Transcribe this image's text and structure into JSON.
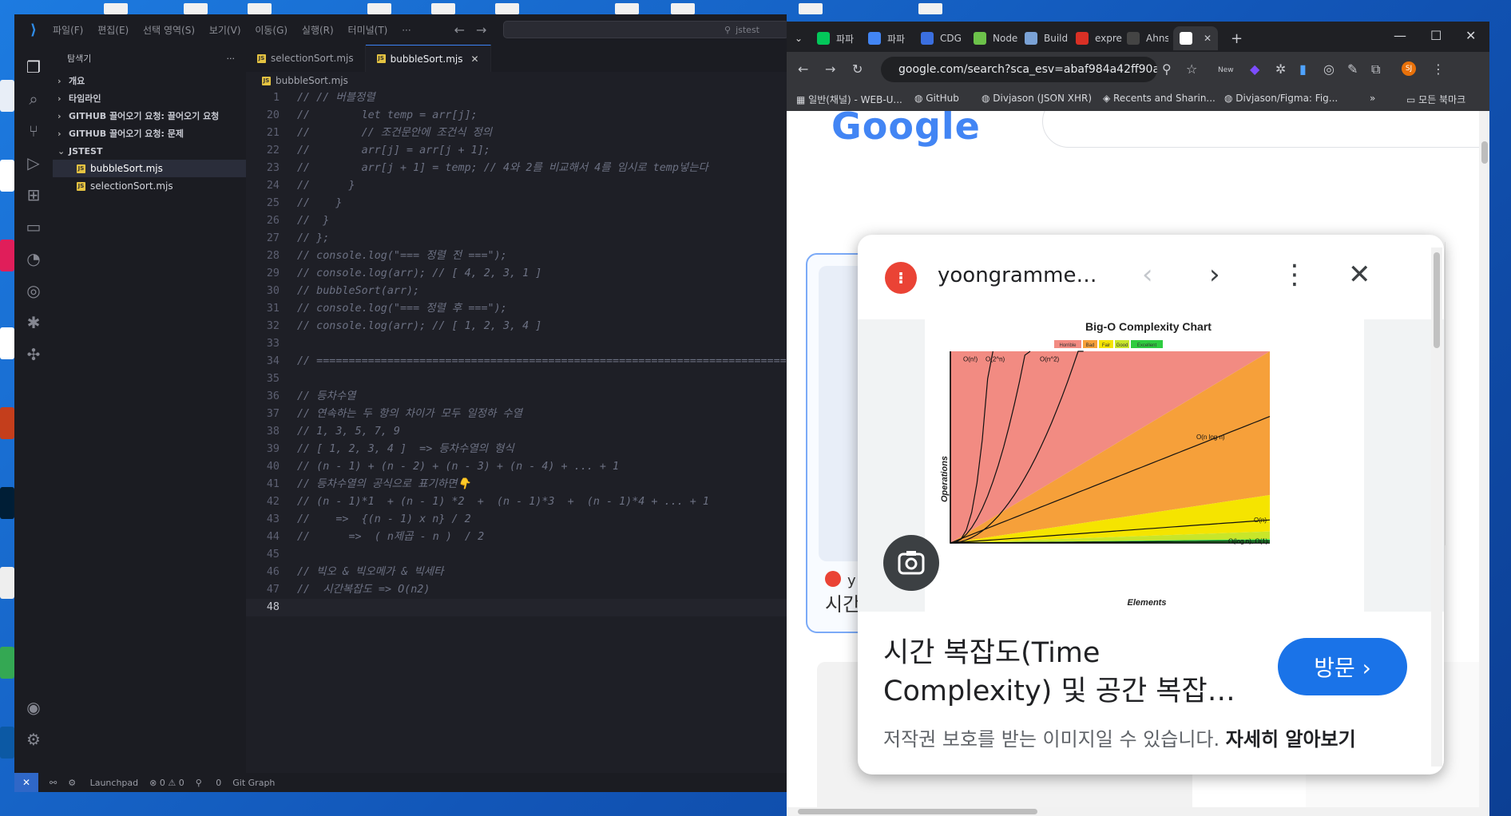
{
  "vscode": {
    "menu": [
      "파일(F)",
      "편집(E)",
      "선택 영역(S)",
      "보기(V)",
      "이동(G)",
      "실행(R)",
      "터미널(T)",
      "···"
    ],
    "search_text": "jstest",
    "explorer_title": "탐색기",
    "explorer_more": "···",
    "sections": [
      "개요",
      "타임라인",
      "GITHUB 끌어오기 요청: 끌어오기 요청",
      "GITHUB 끌어오기 요청: 문제"
    ],
    "folder": "JSTEST",
    "files": [
      "bubbleSort.mjs",
      "selectionSort.mjs"
    ],
    "tabs": [
      {
        "label": "selectionSort.mjs"
      },
      {
        "label": "bubbleSort.mjs"
      }
    ],
    "breadcrumb": "bubbleSort.mjs",
    "lines": [
      {
        "n": "1",
        "t": "// // 버블정렬"
      },
      {
        "n": "20",
        "t": "//        let temp = arr[j];"
      },
      {
        "n": "21",
        "t": "//        // 조건문안에 조건식 정의"
      },
      {
        "n": "22",
        "t": "//        arr[j] = arr[j + 1];"
      },
      {
        "n": "23",
        "t": "//        arr[j + 1] = temp; // 4와 2를 비교해서 4를 임시로 temp넣는다"
      },
      {
        "n": "24",
        "t": "//      }"
      },
      {
        "n": "25",
        "t": "//    }"
      },
      {
        "n": "26",
        "t": "//  }"
      },
      {
        "n": "27",
        "t": "// };"
      },
      {
        "n": "28",
        "t": "// console.log(\"=== 정렬 전 ===\");"
      },
      {
        "n": "29",
        "t": "// console.log(arr); // [ 4, 2, 3, 1 ]"
      },
      {
        "n": "30",
        "t": "// bubbleSort(arr);"
      },
      {
        "n": "31",
        "t": "// console.log(\"=== 정렬 후 ===\");"
      },
      {
        "n": "32",
        "t": "// console.log(arr); // [ 1, 2, 3, 4 ]"
      },
      {
        "n": "33",
        "t": ""
      },
      {
        "n": "34",
        "t": "// ==================================================================================="
      },
      {
        "n": "35",
        "t": ""
      },
      {
        "n": "36",
        "t": "// 등차수열"
      },
      {
        "n": "37",
        "t": "// 연속하는 두 항의 차이가 모두 일정하 수열"
      },
      {
        "n": "38",
        "t": "// 1, 3, 5, 7, 9"
      },
      {
        "n": "39",
        "t": "// [ 1, 2, 3, 4 ]  => 등차수열의 형식"
      },
      {
        "n": "40",
        "t": "// (n - 1) + (n - 2) + (n - 3) + (n - 4) + ... + 1"
      },
      {
        "n": "41",
        "t": "// 등차수열의 공식으로 표기하면👇"
      },
      {
        "n": "42",
        "t": "// (n - 1)*1  + (n - 1) *2  +  (n - 1)*3  +  (n - 1)*4 + ... + 1"
      },
      {
        "n": "43",
        "t": "//    =>  {(n - 1) x n} / 2"
      },
      {
        "n": "44",
        "t": "//      =>  ( n제곱 - n )  / 2"
      },
      {
        "n": "45",
        "t": ""
      },
      {
        "n": "46",
        "t": "// 빅오 & 빅오메가 & 빅세타"
      },
      {
        "n": "47",
        "t": "//  시간복잡도 => O(n2)"
      },
      {
        "n": "48",
        "t": ""
      }
    ],
    "status": {
      "launchpad": "Launchpad",
      "problems": "⊗ 0 ⚠ 0",
      "ports": "0",
      "git_graph": "Git Graph"
    }
  },
  "chrome": {
    "tabs": [
      {
        "label": "파파",
        "color": "#03c75a"
      },
      {
        "label": "파파",
        "color": "#4285f4"
      },
      {
        "label": "CDG",
        "color": "#3b6fe0"
      },
      {
        "label": "Node",
        "color": "#6cc24a"
      },
      {
        "label": "Build",
        "color": "#7aa2d6"
      },
      {
        "label": "expre",
        "color": "#d93025"
      },
      {
        "label": "Ahns",
        "color": "#444444"
      },
      {
        "label": "",
        "color": "#ffffff"
      }
    ],
    "new_tab": "+",
    "url": "google.com/search?sca_esv=abaf984a42ff90a...",
    "bookmarks": [
      "일반(채널) - WEB-U...",
      "GitHub",
      "Divjason (JSON XHR)",
      "Recents and Sharin...",
      "Divjason/Figma: Fig...",
      "모든 북마크"
    ],
    "profile": "SJ",
    "new_badge": "New",
    "page": {
      "logo": "Google",
      "result_title_fragment": "시간",
      "result_site_fragment": "y"
    },
    "preview": {
      "site": "yoongramme…",
      "title": "시간 복잡도(Time Complexity) 및 공간 복잡…",
      "visit": "방문 ›",
      "note": "저작권 보호를 받는 이미지일 수 있습니다.",
      "learn_more": "자세히 알아보기"
    }
  },
  "chart_data": {
    "type": "area",
    "title": "Big-O Complexity Chart",
    "legend": [
      "Horrible",
      "Bad",
      "Fair",
      "Good",
      "Excellent"
    ],
    "legend_colors": [
      "#f28b82",
      "#f6a03a",
      "#f5e400",
      "#c8e62a",
      "#2ecc40"
    ],
    "xlabel": "Elements",
    "ylabel": "Operations",
    "curves": [
      "O(n!)",
      "O(2^n)",
      "O(n^2)",
      "O(n log n)",
      "O(n)",
      "O(log n), O(1)"
    ]
  }
}
